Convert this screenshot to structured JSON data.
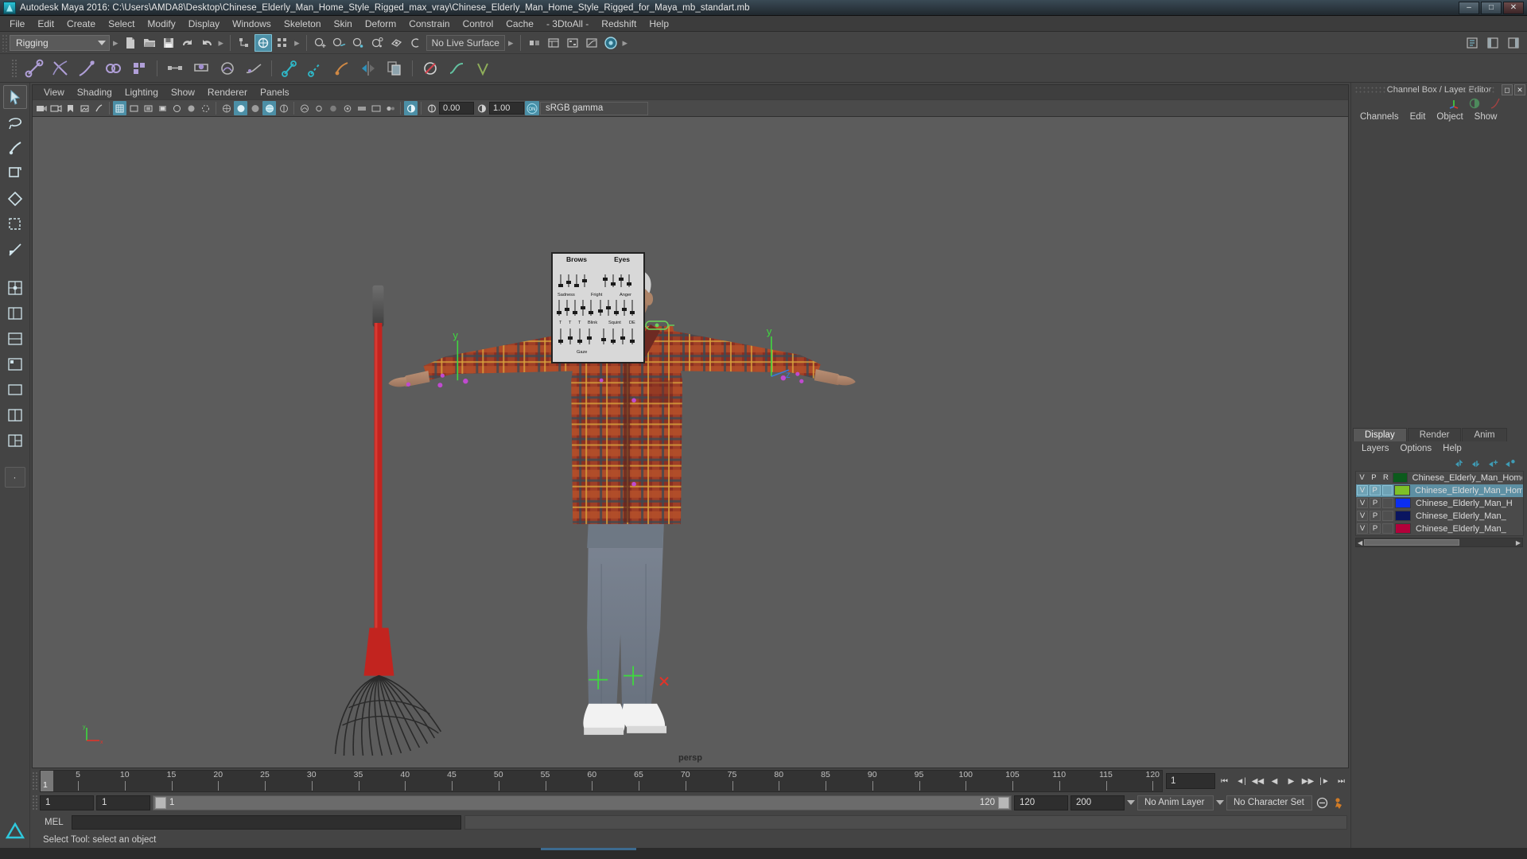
{
  "window": {
    "title": "Autodesk Maya 2016: C:\\Users\\AMDA8\\Desktop\\Chinese_Elderly_Man_Home_Style_Rigged_max_vray\\Chinese_Elderly_Man_Home_Style_Rigged_for_Maya_mb_standart.mb",
    "minimize": "–",
    "maximize": "□",
    "close": "✕"
  },
  "menubar": {
    "items": [
      {
        "label": "File"
      },
      {
        "label": "Edit"
      },
      {
        "label": "Create"
      },
      {
        "label": "Select"
      },
      {
        "label": "Modify"
      },
      {
        "label": "Display"
      },
      {
        "label": "Windows"
      },
      {
        "label": "Skeleton"
      },
      {
        "label": "Skin"
      },
      {
        "label": "Deform"
      },
      {
        "label": "Constrain"
      },
      {
        "label": "Control"
      },
      {
        "label": "Cache"
      },
      {
        "label": "- 3DtoAll -"
      },
      {
        "label": "Redshift"
      },
      {
        "label": "Help"
      }
    ]
  },
  "statusbar": {
    "menuset": "Rigging",
    "live_surface": "No Live Surface"
  },
  "viewport_panel": {
    "menus": [
      {
        "label": "View"
      },
      {
        "label": "Shading"
      },
      {
        "label": "Lighting"
      },
      {
        "label": "Show"
      },
      {
        "label": "Renderer"
      },
      {
        "label": "Panels"
      }
    ],
    "exposure": "0.00",
    "gamma": "1.00",
    "color_mgmt_toggle": "ON",
    "view_transform": "sRGB gamma",
    "camera_label": "persp"
  },
  "control_board": {
    "heading_left": "Brows",
    "heading_right": "Eyes",
    "labels": [
      "Sadness",
      "Fright",
      "Anger",
      "T",
      "T",
      "Blink",
      "Squint",
      "DE"
    ]
  },
  "channel_box": {
    "panel_title": "Channel Box / Layer Editor",
    "menus": [
      {
        "label": "Channels"
      },
      {
        "label": "Edit"
      },
      {
        "label": "Object"
      },
      {
        "label": "Show"
      }
    ]
  },
  "layer_editor": {
    "tabs": [
      {
        "label": "Display",
        "selected": true
      },
      {
        "label": "Render",
        "selected": false
      },
      {
        "label": "Anim",
        "selected": false
      }
    ],
    "menus": [
      {
        "label": "Layers"
      },
      {
        "label": "Options"
      },
      {
        "label": "Help"
      }
    ],
    "column_headers": {
      "v": "V",
      "p": "P",
      "r": "R"
    },
    "layers": [
      {
        "v": "V",
        "p": "P",
        "r": "R",
        "color": "#0b5b1c",
        "name": "Chinese_Elderly_Man_Home_",
        "selected": false
      },
      {
        "v": "V",
        "p": "P",
        "r": "",
        "color": "#7ec128",
        "name": "Chinese_Elderly_Man_Hom",
        "selected": true
      },
      {
        "v": "V",
        "p": "P",
        "r": "",
        "color": "#0b2ef0",
        "name": "Chinese_Elderly_Man_H",
        "selected": false
      },
      {
        "v": "V",
        "p": "P",
        "r": "",
        "color": "#0a1560",
        "name": "Chinese_Elderly_Man_",
        "selected": false
      },
      {
        "v": "V",
        "p": "P",
        "r": "",
        "color": "#b3003a",
        "name": "Chinese_Elderly_Man_",
        "selected": false
      }
    ]
  },
  "time_slider": {
    "ticks": [
      5,
      10,
      15,
      20,
      25,
      30,
      35,
      40,
      45,
      50,
      55,
      60,
      65,
      70,
      75,
      80,
      85,
      90,
      95,
      100,
      105,
      110,
      115,
      120
    ],
    "current_frame": "1",
    "current_frame_field": "1",
    "range_start": 1,
    "range_end": 120
  },
  "range_slider": {
    "anim_start": "1",
    "range_start": "1",
    "slider_left_value": "1",
    "slider_right_value": "120",
    "range_end": "120",
    "anim_end": "200",
    "anim_layer": "No Anim Layer",
    "character_set": "No Character Set"
  },
  "command_line": {
    "prompt": "MEL",
    "input_value": "",
    "output_value": ""
  },
  "help_line": {
    "text": "Select Tool: select an object"
  },
  "icons": {
    "new_scene": "new-scene-icon",
    "open_scene": "open-scene-icon",
    "save_scene": "save-scene-icon",
    "undo": "undo-icon",
    "redo": "redo-icon",
    "select_hierarchy": "select-by-hierarchy-icon",
    "select_object": "select-by-object-icon",
    "select_component": "select-by-component-icon",
    "snap_grid": "snap-to-grid-icon",
    "snap_curve": "snap-to-curve-icon",
    "snap_point": "snap-to-point-icon",
    "snap_projected": "snap-to-projected-center-icon",
    "snap_view_plane": "snap-to-view-plane-icon",
    "make_live": "make-live-icon",
    "select_tool": "select-tool-icon",
    "lasso_tool": "lasso-tool-icon",
    "paint_select_tool": "paint-select-tool-icon",
    "move_tool": "move-tool-icon",
    "rotate_tool": "rotate-tool-icon",
    "scale_tool": "scale-tool-icon",
    "last_tool": "last-tool-used-icon",
    "gear": "gear-icon",
    "maximize_panel": "maximize-panel-icon",
    "close_panel": "close-panel-icon",
    "go_to_start": "go-to-start-icon",
    "step_back_key": "step-back-key-icon",
    "step_back": "step-back-frame-icon",
    "play_back": "play-backwards-icon",
    "play_forward": "play-forwards-icon",
    "step_forward": "step-forward-frame-icon",
    "step_forward_key": "step-forward-key-icon",
    "go_to_end": "go-to-end-icon",
    "anim_pref": "animation-preferences-icon",
    "char_set": "character-set-icon"
  }
}
